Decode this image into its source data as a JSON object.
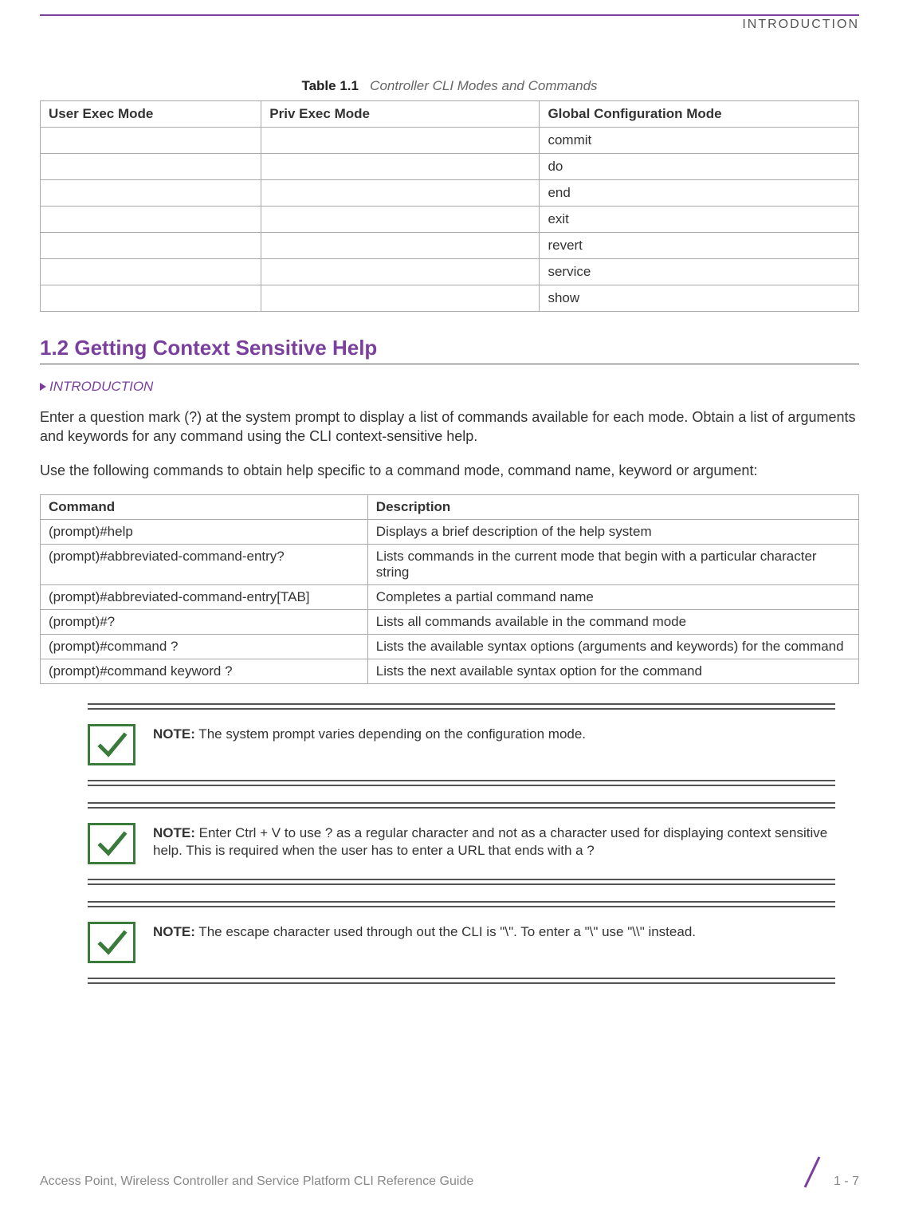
{
  "header": {
    "section": "INTRODUCTION"
  },
  "table1": {
    "caption_number": "Table 1.1",
    "caption_text": "Controller CLI Modes and Commands",
    "headers": [
      "User Exec Mode",
      "Priv Exec Mode",
      "Global Configuration Mode"
    ],
    "rows": [
      [
        "",
        "",
        "commit"
      ],
      [
        "",
        "",
        "do"
      ],
      [
        "",
        "",
        "end"
      ],
      [
        "",
        "",
        "exit"
      ],
      [
        "",
        "",
        "revert"
      ],
      [
        "",
        "",
        "service"
      ],
      [
        "",
        "",
        "show"
      ]
    ]
  },
  "section": {
    "title": "1.2 Getting Context Sensitive Help",
    "breadcrumb": "INTRODUCTION",
    "para1": "Enter a question mark (?) at the system prompt to display a list of commands available for each mode. Obtain a list of arguments and keywords for any command using the CLI context-sensitive help.",
    "para2": "Use the following commands to obtain help specific to a command mode, command name, keyword or argument:"
  },
  "table2": {
    "headers": [
      "Command",
      "Description"
    ],
    "rows": [
      [
        "(prompt)#help",
        "Displays a brief description of the help system"
      ],
      [
        "(prompt)#abbreviated-command-entry?",
        "Lists commands in the current mode that begin with a particular character string"
      ],
      [
        "(prompt)#abbreviated-command-entry[TAB]",
        "Completes a partial command name"
      ],
      [
        "(prompt)#?",
        "Lists all commands available in the command mode"
      ],
      [
        "(prompt)#command ?",
        "Lists the available syntax options (arguments and keywords) for the command"
      ],
      [
        "(prompt)#command keyword ?",
        "Lists the next available syntax option for the command"
      ]
    ]
  },
  "notes": [
    {
      "label": "NOTE:",
      "text": " The system prompt varies depending on the configuration mode."
    },
    {
      "label": "NOTE:",
      "text": " Enter Ctrl + V to use ? as a regular character and not as a character used for displaying context sensitive help. This is required when the user has to enter a URL that ends with a ?"
    },
    {
      "label": "NOTE:",
      "text": " The escape character used through out the CLI is \"\\\". To enter a \"\\\" use \"\\\\\" instead."
    }
  ],
  "footer": {
    "guide": "Access Point, Wireless Controller and Service Platform CLI Reference Guide",
    "page": "1 - 7"
  }
}
